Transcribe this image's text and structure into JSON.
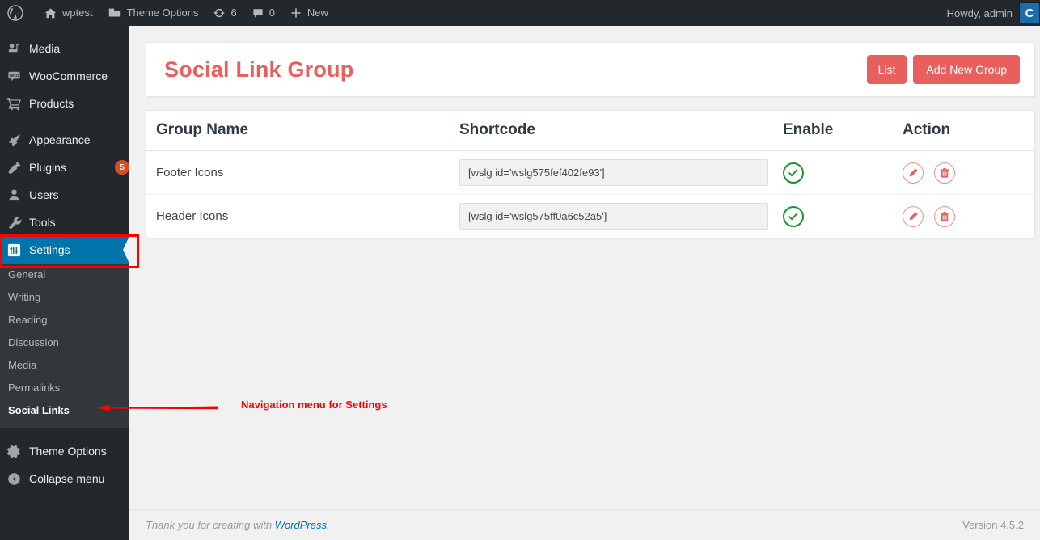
{
  "adminbar": {
    "logo_icon": "wordpress-logo-icon",
    "site_name": "wptest",
    "site_icon": "home-icon",
    "theme_options": "Theme Options",
    "theme_options_icon": "folder-icon",
    "updates_icon": "updates-sync-icon",
    "updates_count": "6",
    "comments_icon": "comment-bubble-icon",
    "comments_count": "0",
    "new_icon": "plus-icon",
    "new_label": "New",
    "howdy": "Howdy, admin",
    "avatar_icon": "user-avatar-icon",
    "avatar_letter": "C"
  },
  "sidebar": {
    "items": [
      {
        "label": "Media",
        "icon": "media-icon",
        "badge": null,
        "current": false
      },
      {
        "label": "WooCommerce",
        "icon": "woocommerce-icon",
        "badge": null,
        "current": false
      },
      {
        "label": "Products",
        "icon": "cart-icon",
        "badge": null,
        "current": false
      },
      {
        "label": "Appearance",
        "icon": "paintbrush-icon",
        "badge": null,
        "current": false
      },
      {
        "label": "Plugins",
        "icon": "plugin-icon",
        "badge": "5",
        "current": false
      },
      {
        "label": "Users",
        "icon": "user-icon",
        "badge": null,
        "current": false
      },
      {
        "label": "Tools",
        "icon": "wrench-icon",
        "badge": null,
        "current": false
      },
      {
        "label": "Settings",
        "icon": "settings-icon",
        "badge": null,
        "current": true
      }
    ],
    "submenu": [
      {
        "label": "General",
        "current": false
      },
      {
        "label": "Writing",
        "current": false
      },
      {
        "label": "Reading",
        "current": false
      },
      {
        "label": "Discussion",
        "current": false
      },
      {
        "label": "Media",
        "current": false
      },
      {
        "label": "Permalinks",
        "current": false
      },
      {
        "label": "Social Links",
        "current": true
      }
    ],
    "bottom_items": [
      {
        "label": "Theme Options",
        "icon": "gear-icon"
      },
      {
        "label": "Collapse menu",
        "icon": "collapse-arrow-icon"
      }
    ]
  },
  "main": {
    "page_title": "Social Link Group",
    "buttons": {
      "list": "List",
      "add_new_group": "Add New Group"
    },
    "table": {
      "headers": [
        "Group Name",
        "Shortcode",
        "Enable",
        "Action"
      ],
      "rows": [
        {
          "group_name": "Footer Icons",
          "shortcode": "[wslg id='wslg575fef402fe93']",
          "enabled": true,
          "enable_icon": "check-circle-icon",
          "edit_icon": "pencil-icon",
          "delete_icon": "trash-icon"
        },
        {
          "group_name": "Header Icons",
          "shortcode": "[wslg id='wslg575ff0a6c52a5']",
          "enabled": true,
          "enable_icon": "check-circle-icon",
          "edit_icon": "pencil-icon",
          "delete_icon": "trash-icon"
        }
      ]
    }
  },
  "annotation": {
    "text": "Navigation menu for Settings",
    "arrow_icon": "left-arrow-annotation-icon",
    "color": "#ff0000"
  },
  "footer": {
    "thanks_prefix": "Thank you for creating with ",
    "wordpress_link": "WordPress",
    "thanks_suffix": ".",
    "version": "Version 4.5.2"
  },
  "colors": {
    "accent_coral": "#e8605d",
    "admin_blue": "#0073aa",
    "sidebar_dark": "#23282d",
    "submenu_dark": "#32373c",
    "badge_orange": "#d54e21",
    "success_green": "#1a9431",
    "annotation_red": "#ff0000"
  }
}
